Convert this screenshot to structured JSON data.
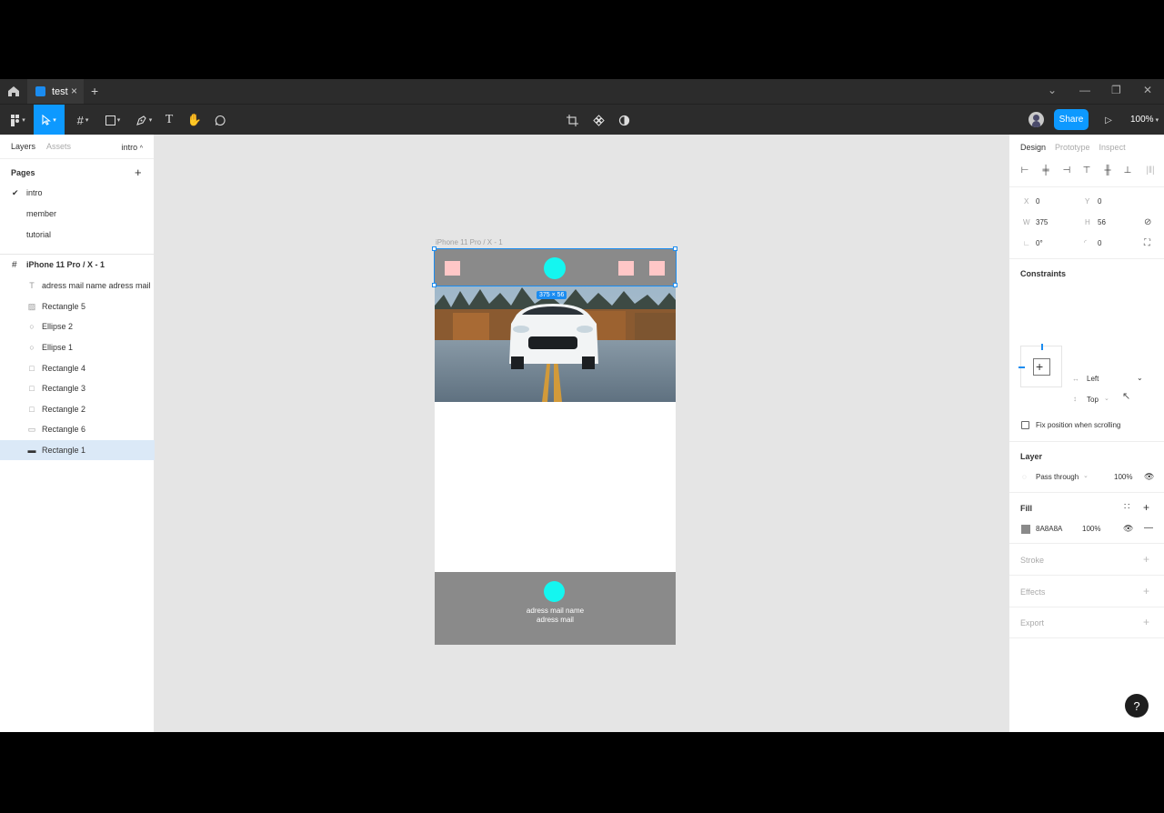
{
  "tabbar": {
    "file_tab": "test"
  },
  "toolbar": {
    "share": "Share",
    "zoom": "100%"
  },
  "left": {
    "tabs": {
      "layers": "Layers",
      "assets": "Assets",
      "page_selector": "intro"
    },
    "pages_title": "Pages",
    "pages": [
      "intro",
      "member",
      "tutorial"
    ],
    "frame_name": "iPhone 11 Pro / X - 1",
    "layers": [
      {
        "label": "adress mail name adress mail",
        "icon": "text-icon"
      },
      {
        "label": "Rectangle 5",
        "icon": "image-icon"
      },
      {
        "label": "Ellipse 2",
        "icon": "ellipse-icon"
      },
      {
        "label": "Ellipse 1",
        "icon": "ellipse-icon"
      },
      {
        "label": "Rectangle 4",
        "icon": "rectangle-icon"
      },
      {
        "label": "Rectangle 3",
        "icon": "rectangle-icon"
      },
      {
        "label": "Rectangle 2",
        "icon": "rectangle-icon"
      },
      {
        "label": "Rectangle 6",
        "icon": "rectangle-icon"
      },
      {
        "label": "Rectangle 1",
        "icon": "line-icon",
        "selected": true
      }
    ]
  },
  "canvas": {
    "frame_label": "iPhone 11 Pro / X - 1",
    "size_badge": "375 × 56",
    "footer_line1": "adress mail name",
    "footer_line2": "adress mail",
    "fill_color": "#8a8a8a",
    "accent_color": "#14f6f0",
    "pink_color": "#ffc7c7"
  },
  "right": {
    "tabs": {
      "design": "Design",
      "prototype": "Prototype",
      "inspect": "Inspect"
    },
    "x_label": "X",
    "x": "0",
    "y_label": "Y",
    "y": "0",
    "w_label": "W",
    "w": "375",
    "h_label": "H",
    "h": "56",
    "rotation": "0°",
    "radius": "0",
    "constraints_title": "Constraints",
    "constraint_h": "Left",
    "constraint_v": "Top",
    "fix_position": "Fix position when scrolling",
    "layer_title": "Layer",
    "blend": "Pass through",
    "layer_opacity": "100%",
    "fill_title": "Fill",
    "fill_hex": "8A8A8A",
    "fill_opacity": "100%",
    "stroke_title": "Stroke",
    "effects_title": "Effects",
    "export_title": "Export"
  },
  "help": "?"
}
